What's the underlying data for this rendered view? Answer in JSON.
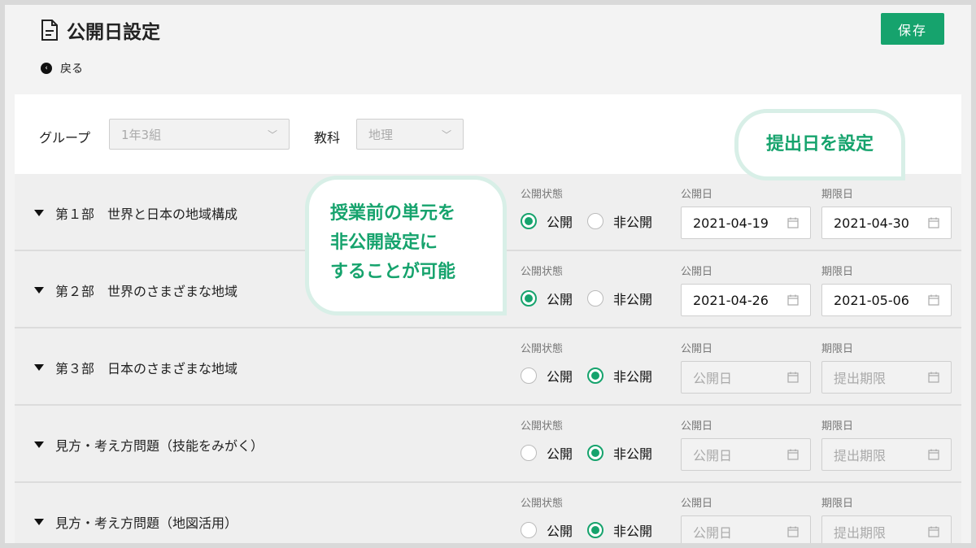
{
  "header": {
    "title": "公開日設定",
    "back_label": "戻る",
    "save_label": "保存",
    "accent_color": "#16a36d"
  },
  "filter": {
    "group_label": "グループ",
    "group_value": "1年3組",
    "subject_label": "教科",
    "subject_value": "地理"
  },
  "columns": {
    "status": "公開状態",
    "open_date": "公開日",
    "due_date": "期限日"
  },
  "radio_labels": {
    "public": "公開",
    "private": "非公開"
  },
  "units": [
    {
      "title": "第１部　世界と日本の地域構成",
      "status": "public",
      "open_date": "2021-04-19",
      "due_date": "2021-04-30",
      "open_placeholder": "公開日",
      "due_placeholder": "提出期限"
    },
    {
      "title": "第２部　世界のさまざまな地域",
      "status": "public",
      "open_date": "2021-04-26",
      "due_date": "2021-05-06",
      "open_placeholder": "公開日",
      "due_placeholder": "提出期限"
    },
    {
      "title": "第３部　日本のさまざまな地域",
      "status": "private",
      "open_date": "",
      "due_date": "",
      "open_placeholder": "公開日",
      "due_placeholder": "提出期限"
    },
    {
      "title": "見方・考え方問題（技能をみがく）",
      "status": "private",
      "open_date": "",
      "due_date": "",
      "open_placeholder": "公開日",
      "due_placeholder": "提出期限"
    },
    {
      "title": "見方・考え方問題（地図活用）",
      "status": "private",
      "open_date": "",
      "due_date": "",
      "open_placeholder": "公開日",
      "due_placeholder": "提出期限"
    }
  ],
  "callouts": {
    "deadline": "提出日を設定",
    "private_line1": "授業前の単元を",
    "private_line2": "非公開設定に",
    "private_line3": "することが可能"
  }
}
